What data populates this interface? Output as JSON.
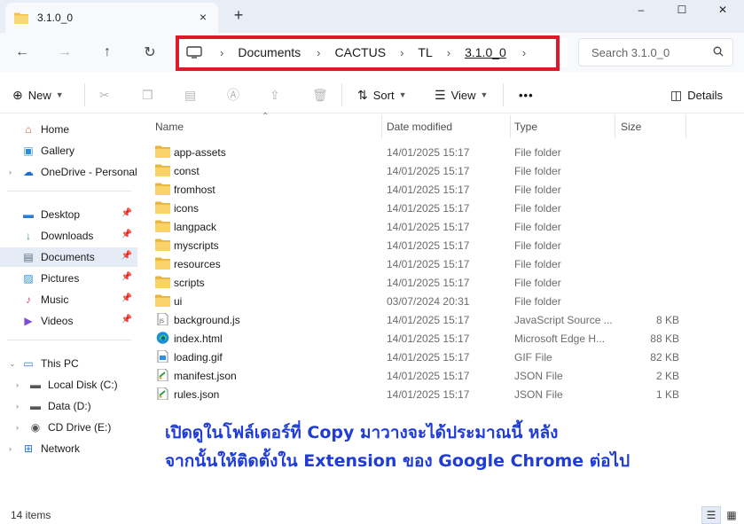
{
  "tab": {
    "title": "3.1.0_0",
    "close_icon": "close-icon",
    "new_tab": "+"
  },
  "window_controls": {
    "minimize": "–",
    "maximize": "☐",
    "close": "✕"
  },
  "nav": {
    "back": "←",
    "forward": "→",
    "up": "↑",
    "refresh": "↻"
  },
  "breadcrumb": [
    "Documents",
    "CACTUS",
    "TL",
    "3.1.0_0"
  ],
  "breadcrumb_sep": "›",
  "highlight_color": "#e0192a",
  "search": {
    "placeholder": "Search 3.1.0_0"
  },
  "commands": {
    "new": "New",
    "sort": "Sort",
    "view": "View",
    "more": "•••",
    "details": "Details"
  },
  "sidebar": {
    "home": "Home",
    "gallery": "Gallery",
    "onedrive": "OneDrive - Personal",
    "desktop": "Desktop",
    "downloads": "Downloads",
    "documents": "Documents",
    "pictures": "Pictures",
    "music": "Music",
    "videos": "Videos",
    "this_pc": "This PC",
    "local_disk": "Local Disk (C:)",
    "data_disk": "Data (D:)",
    "cd_drive": "CD Drive (E:)",
    "network": "Network"
  },
  "columns": {
    "name": "Name",
    "date": "Date modified",
    "type": "Type",
    "size": "Size"
  },
  "files": [
    {
      "name": "app-assets",
      "date": "14/01/2025 15:17",
      "type": "File folder",
      "size": "",
      "icon": "folder"
    },
    {
      "name": "const",
      "date": "14/01/2025 15:17",
      "type": "File folder",
      "size": "",
      "icon": "folder"
    },
    {
      "name": "fromhost",
      "date": "14/01/2025 15:17",
      "type": "File folder",
      "size": "",
      "icon": "folder"
    },
    {
      "name": "icons",
      "date": "14/01/2025 15:17",
      "type": "File folder",
      "size": "",
      "icon": "folder"
    },
    {
      "name": "langpack",
      "date": "14/01/2025 15:17",
      "type": "File folder",
      "size": "",
      "icon": "folder"
    },
    {
      "name": "myscripts",
      "date": "14/01/2025 15:17",
      "type": "File folder",
      "size": "",
      "icon": "folder"
    },
    {
      "name": "resources",
      "date": "14/01/2025 15:17",
      "type": "File folder",
      "size": "",
      "icon": "folder"
    },
    {
      "name": "scripts",
      "date": "14/01/2025 15:17",
      "type": "File folder",
      "size": "",
      "icon": "folder"
    },
    {
      "name": "ui",
      "date": "03/07/2024 20:31",
      "type": "File folder",
      "size": "",
      "icon": "folder"
    },
    {
      "name": "background.js",
      "date": "14/01/2025 15:17",
      "type": "JavaScript Source ...",
      "size": "8 KB",
      "icon": "js-file"
    },
    {
      "name": "index.html",
      "date": "14/01/2025 15:17",
      "type": "Microsoft Edge H...",
      "size": "88 KB",
      "icon": "edge"
    },
    {
      "name": "loading.gif",
      "date": "14/01/2025 15:17",
      "type": "GIF File",
      "size": "82 KB",
      "icon": "image"
    },
    {
      "name": "manifest.json",
      "date": "14/01/2025 15:17",
      "type": "JSON File",
      "size": "2 KB",
      "icon": "json"
    },
    {
      "name": "rules.json",
      "date": "14/01/2025 15:17",
      "type": "JSON File",
      "size": "1 KB",
      "icon": "json"
    }
  ],
  "annotation": {
    "line1": "เปิดดูในโฟล์เดอร์ที่ Copy มาวางจะได้ประมาณนี้ หลัง",
    "line2": "จากนั้นให้ติดตั้งใน Extension ของ Google Chrome ต่อไป"
  },
  "status": {
    "count": "14 items"
  }
}
